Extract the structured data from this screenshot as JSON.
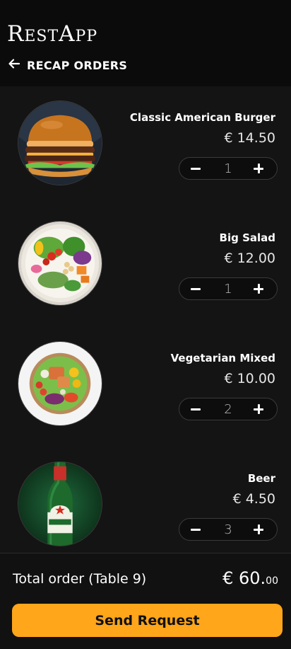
{
  "header": {
    "app_title": "RestApp",
    "screen_title": "RECAP ORDERS"
  },
  "items": [
    {
      "name": "Classic American Burger",
      "price": "€ 14.50",
      "quantity": "1",
      "icon": "burger-image"
    },
    {
      "name": "Big Salad",
      "price": "€ 12.00",
      "quantity": "1",
      "icon": "salad-image"
    },
    {
      "name": "Vegetarian Mixed",
      "price": "€ 10.00",
      "quantity": "2",
      "icon": "vegetarian-bowl-image"
    },
    {
      "name": "Beer",
      "price": "€ 4.50",
      "quantity": "3",
      "icon": "beer-bottle-image"
    }
  ],
  "footer": {
    "total_label": "Total order (Table 9)",
    "total_main": "€ 60.",
    "total_cents": "00",
    "send_label": "Send Request"
  },
  "colors": {
    "accent": "#ffa61a",
    "background": "#141414",
    "header_background": "#0b0b0b"
  }
}
